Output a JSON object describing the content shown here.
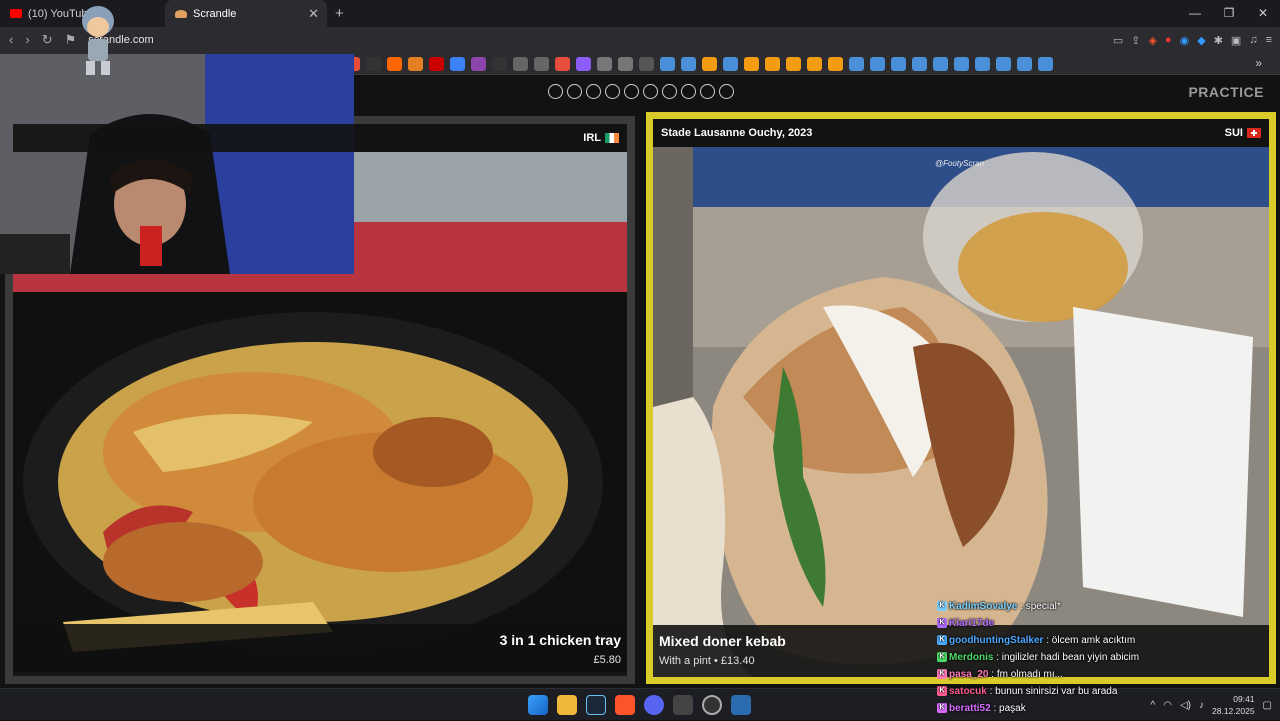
{
  "browser": {
    "tabs": [
      {
        "label": "(10) YouTube",
        "icon": "youtube-icon",
        "active": false
      },
      {
        "label": "Scrandle",
        "icon": "scrandle-icon",
        "active": true
      }
    ],
    "url": "scrandle.com"
  },
  "game": {
    "round_dots": 10,
    "mode": "PRACTICE",
    "left": {
      "country": "IRL",
      "title": "3 in 1 chicken tray",
      "price": "£5.80"
    },
    "right": {
      "location": "Stade Lausanne Ouchy, 2023",
      "country": "SUI",
      "title": "Mixed doner kebab",
      "price": "With a pint • £13.40",
      "watermark": "@FootyScran"
    }
  },
  "chat": [
    {
      "user": "KadimSovalye",
      "msg": "special*",
      "color": "#7ad0ff"
    },
    {
      "user": "Kiari17de",
      "msg": "",
      "color": "#b06bff"
    },
    {
      "user": "goodhuntingStalker",
      "msg": "ölcem amk acıktım",
      "color": "#4aa8ff"
    },
    {
      "user": "Merdonis",
      "msg": "ingilizler hadi bean yiyin abicim",
      "color": "#4cd964"
    },
    {
      "user": "pasa_20",
      "msg": "fm olmadı mı...",
      "color": "#ff7ab8"
    },
    {
      "user": "satocuk",
      "msg": "bunun sinirsizi var bu arada",
      "color": "#ff5d8f"
    },
    {
      "user": "beratti52",
      "msg": "paşak",
      "color": "#d96bff"
    }
  ],
  "taskbar": {
    "time": "09:41",
    "date": "28.12.2025"
  },
  "colors": {
    "selected_border": "#d9cc2a",
    "unselected_border": "#3b3b3b"
  }
}
